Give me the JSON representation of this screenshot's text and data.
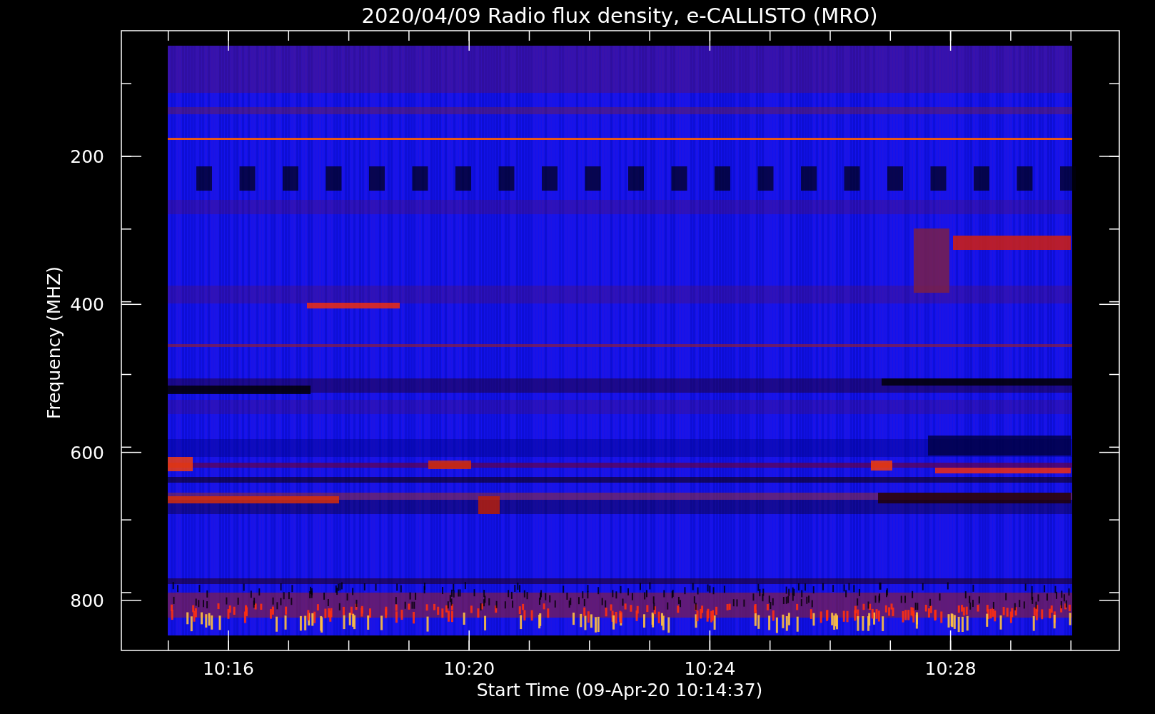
{
  "title": "2020/04/09  Radio flux density, e-CALLISTO (MRO)",
  "y_axis": {
    "label": "Frequency (MHZ)",
    "ticks": [
      "200",
      "400",
      "600",
      "800"
    ]
  },
  "x_axis": {
    "label": "Start Time (09-Apr-20 10:14:37)",
    "ticks": [
      "10:16",
      "10:20",
      "10:24",
      "10:28"
    ]
  }
}
